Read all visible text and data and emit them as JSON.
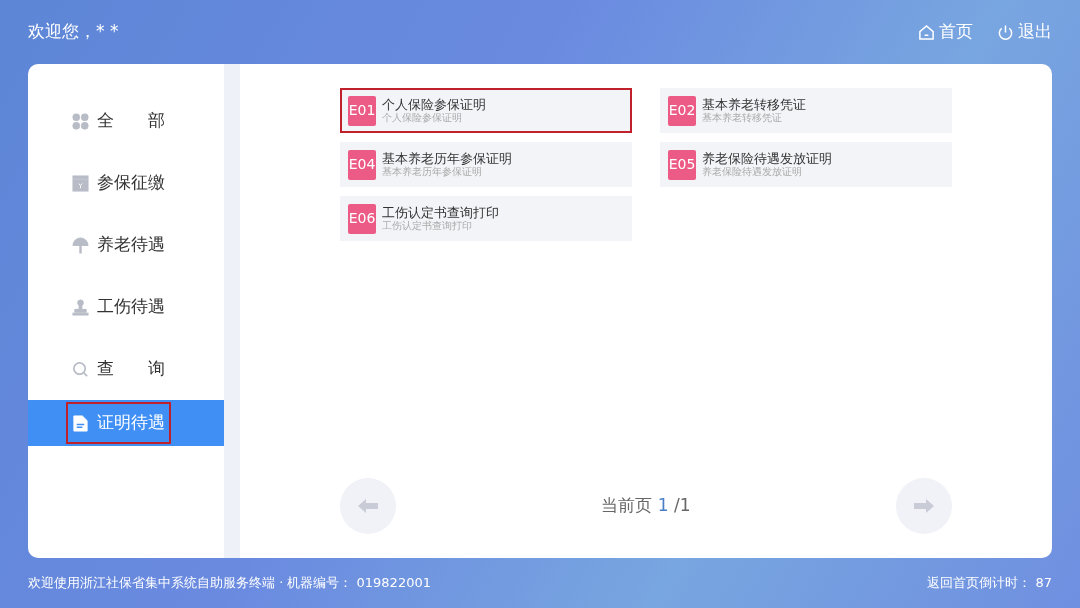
{
  "header": {
    "welcome": "欢迎您，* *",
    "home": "首页",
    "logout": "退出"
  },
  "sidebar": {
    "items": [
      {
        "label": "全　　部",
        "selected": false,
        "highlighted": false
      },
      {
        "label": "参保征缴",
        "selected": false,
        "highlighted": false
      },
      {
        "label": "养老待遇",
        "selected": false,
        "highlighted": false
      },
      {
        "label": "工伤待遇",
        "selected": false,
        "highlighted": false
      },
      {
        "label": "查　　询",
        "selected": false,
        "highlighted": false
      },
      {
        "label": "证明待遇",
        "selected": true,
        "highlighted": true
      }
    ]
  },
  "services": [
    {
      "code": "E01",
      "title": "个人保险参保证明",
      "subtitle": "个人保险参保证明",
      "highlighted": true
    },
    {
      "code": "E02",
      "title": "基本养老转移凭证",
      "subtitle": "基本养老转移凭证",
      "highlighted": false
    },
    {
      "code": "E04",
      "title": "基本养老历年参保证明",
      "subtitle": "基本养老历年参保证明",
      "highlighted": false
    },
    {
      "code": "E05",
      "title": "养老保险待遇发放证明",
      "subtitle": "养老保险待遇发放证明",
      "highlighted": false
    },
    {
      "code": "E06",
      "title": "工伤认定书查询打印",
      "subtitle": "工伤认定书查询打印",
      "highlighted": false
    }
  ],
  "pager": {
    "label": "当前页",
    "current": "1",
    "total": "/1",
    "prev_disabled": true,
    "next_disabled": true
  },
  "footer": {
    "info": "欢迎使用浙江社保省集中系统自助服务终端 · 机器编号： 019822001",
    "countdown": "返回首页倒计时： 87"
  }
}
